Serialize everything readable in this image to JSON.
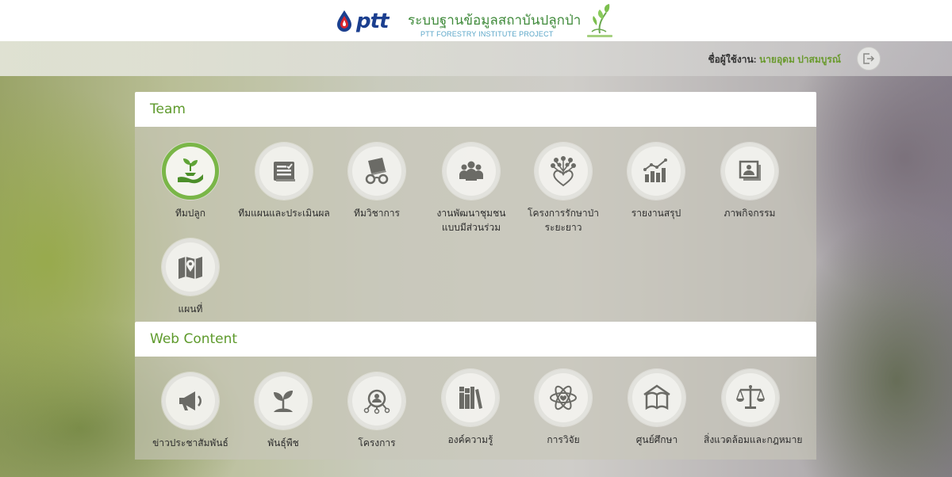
{
  "header": {
    "brand_text": "ptt",
    "title_th": "ระบบฐานข้อมูลสถาบันปลูกป่า",
    "title_en": "PTT FORESTRY INSTITUTE PROJECT"
  },
  "userbar": {
    "user_prefix": "ชื่อผู้ใช้งาน:",
    "user_name": "นายอุดม ปาสมบูรณ์",
    "logout_icon": "logout-icon"
  },
  "sections": {
    "team": {
      "title": "Team",
      "items": [
        {
          "label": "ทีมปลูก",
          "icon": "plant-hand-icon",
          "active": true
        },
        {
          "label": "ทีมแผนและประเมินผล",
          "icon": "document-check-icon"
        },
        {
          "label": "ทีมวิชาการ",
          "icon": "book-glasses-icon"
        },
        {
          "label_1": "งานพัฒนาชุมชน",
          "label_2": "แบบมีส่วนร่วม",
          "icon": "people-group-icon"
        },
        {
          "label_1": "โครงการรักษาป่า",
          "label_2": "ระยะยาว",
          "icon": "tree-heart-icon"
        },
        {
          "label": "รายงานสรุป",
          "icon": "bar-chart-icon"
        },
        {
          "label": "ภาพกิจกรรม",
          "icon": "photo-gallery-icon"
        },
        {
          "label": "แผนที่",
          "icon": "map-pin-icon"
        }
      ]
    },
    "web_content": {
      "title": "Web Content",
      "items": [
        {
          "label": "ข่าวประชาสัมพันธ์",
          "icon": "megaphone-icon"
        },
        {
          "label": "พันธุ์พืช",
          "icon": "sprout-icon"
        },
        {
          "label": "โครงการ",
          "icon": "network-icon"
        },
        {
          "label": "องค์ความรู้",
          "icon": "books-icon"
        },
        {
          "label": "การวิจัย",
          "icon": "atom-icon"
        },
        {
          "label": "ศูนย์ศึกษา",
          "icon": "open-book-house-icon"
        },
        {
          "label": "สิ่งแวดล้อมและกฎหมาย",
          "icon": "scales-icon"
        }
      ]
    }
  },
  "colors": {
    "accent_green": "#5e9a2c",
    "active_ring": "#7ab648",
    "icon_gray": "#6b6b66",
    "ptt_blue": "#1b3f8f",
    "ptt_red": "#d8262e"
  }
}
